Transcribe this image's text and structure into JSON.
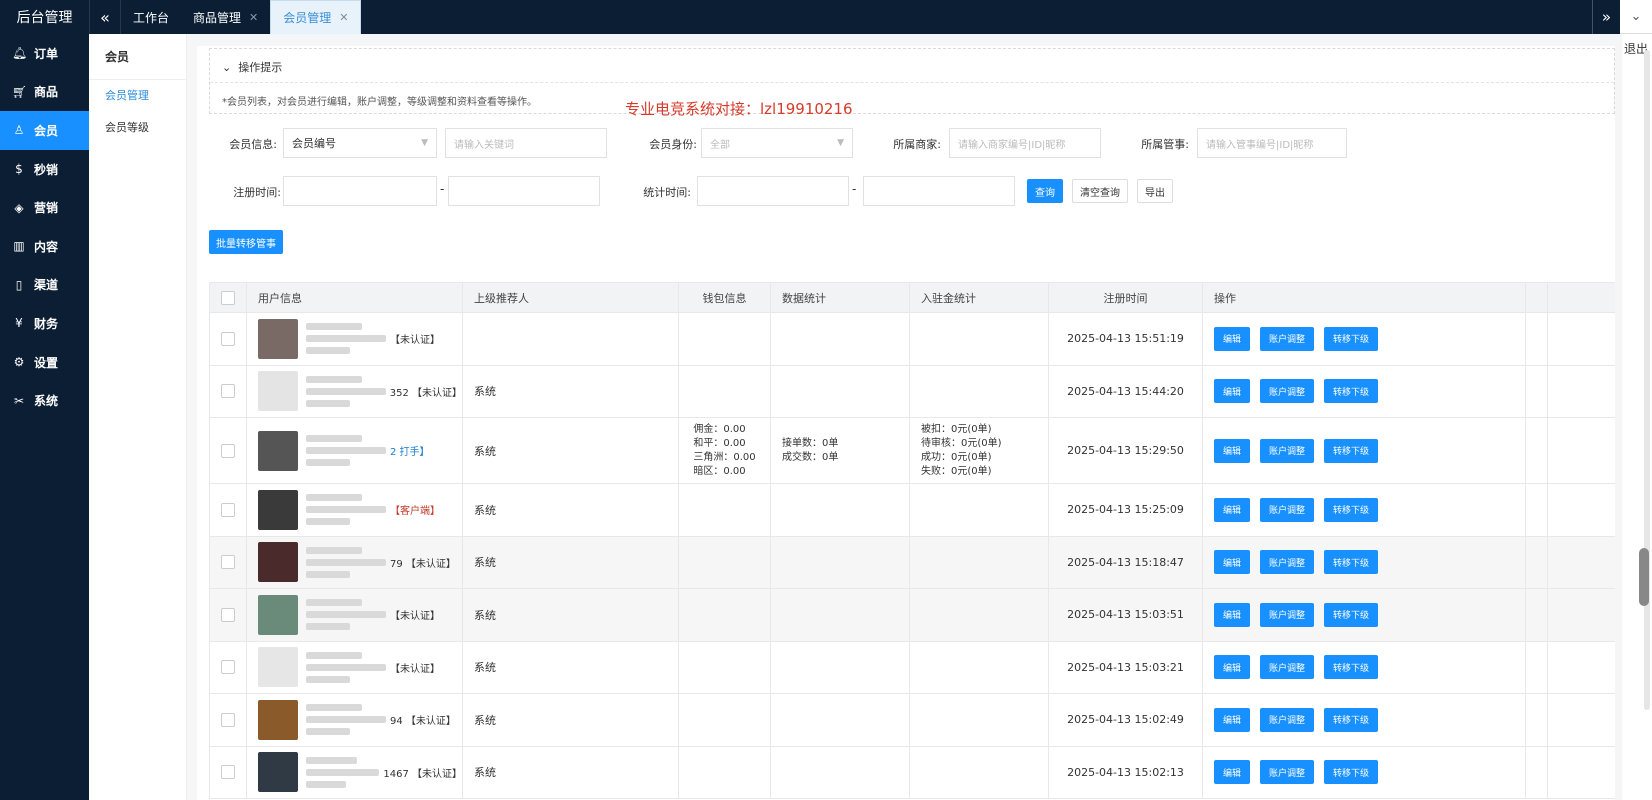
{
  "brand": "后台管理",
  "tabs": [
    {
      "label": "工作台",
      "closable": false,
      "active": false
    },
    {
      "label": "商品管理",
      "closable": true,
      "active": false
    },
    {
      "label": "会员管理",
      "closable": true,
      "active": true
    }
  ],
  "sidebar": {
    "items": [
      {
        "label": "订单",
        "icon": "bell-icon"
      },
      {
        "label": "商品",
        "icon": "cart-icon"
      },
      {
        "label": "会员",
        "icon": "user-icon",
        "active": true
      },
      {
        "label": "秒销",
        "icon": "dollar-icon"
      },
      {
        "label": "营销",
        "icon": "cube-icon"
      },
      {
        "label": "内容",
        "icon": "book-icon"
      },
      {
        "label": "渠道",
        "icon": "phone-icon"
      },
      {
        "label": "财务",
        "icon": "yen-icon"
      },
      {
        "label": "设置",
        "icon": "gear-icon"
      },
      {
        "label": "系统",
        "icon": "tools-icon"
      }
    ]
  },
  "submenu": {
    "title": "会员",
    "items": [
      {
        "label": "会员管理",
        "active": true
      },
      {
        "label": "会员等级",
        "active": false
      }
    ]
  },
  "logout": "退出",
  "tips": {
    "title": "操作提示",
    "text": "*会员列表，对会员进行编辑，账户调整，等级调整和资料查看等操作。"
  },
  "watermark": "专业电竞系统对接：lzl19910216",
  "filters": {
    "member_info_label": "会员信息:",
    "member_info_select": "会员编号",
    "keyword_placeholder": "请输入关键词",
    "identity_label": "会员身份:",
    "identity_select": "全部",
    "merchant_label": "所属商家:",
    "merchant_placeholder": "请输入商家编号|ID|昵称",
    "manager_label": "所属管事:",
    "manager_placeholder": "请输入管事编号|ID|昵称",
    "register_label": "注册时间:",
    "stat_label": "统计时间:",
    "range_sep": "-",
    "query": "查询",
    "clear": "清空查询",
    "export": "导出"
  },
  "batch_button": "批量转移管事",
  "table": {
    "headers": [
      "用户信息",
      "上级推荐人",
      "钱包信息",
      "数据统计",
      "入驻金统计",
      "注册时间",
      "操作"
    ],
    "actions": {
      "edit": "编辑",
      "adjust": "账户调整",
      "transfer": "转移下级"
    },
    "rows": [
      {
        "user_tag": "【未认证】",
        "tag_color": "normal",
        "referrer": "",
        "wallet": [],
        "stats": [],
        "deposit": [],
        "time": "2025-04-13 15:51:19",
        "alt": false
      },
      {
        "user_tag": "352 【未认证】",
        "tag_color": "normal",
        "referrer": "系统",
        "wallet": [],
        "stats": [],
        "deposit": [],
        "time": "2025-04-13 15:44:20",
        "alt": false
      },
      {
        "user_tag": "2 打手】",
        "tag_color": "blue",
        "referrer": "系统",
        "wallet": [
          "佣金：0.00",
          "和平：0.00",
          "三角洲：0.00",
          "暗区：0.00"
        ],
        "stats": [
          "接单数：0单",
          "成交数：0单"
        ],
        "deposit": [
          "被扣：0元(0单)",
          "待审核：0元(0单)",
          "成功：0元(0单)",
          "失败：0元(0单)"
        ],
        "time": "2025-04-13 15:29:50",
        "alt": false
      },
      {
        "user_tag": "【客户端】",
        "tag_color": "red",
        "referrer": "系统",
        "wallet": [],
        "stats": [],
        "deposit": [],
        "time": "2025-04-13 15:25:09",
        "alt": false
      },
      {
        "user_tag": "79 【未认证】",
        "tag_color": "normal",
        "referrer": "系统",
        "wallet": [],
        "stats": [],
        "deposit": [],
        "time": "2025-04-13 15:18:47",
        "alt": true
      },
      {
        "user_tag": "【未认证】",
        "tag_color": "normal",
        "referrer": "系统",
        "wallet": [],
        "stats": [],
        "deposit": [],
        "time": "2025-04-13 15:03:51",
        "alt": true
      },
      {
        "user_tag": "【未认证】",
        "tag_color": "normal",
        "referrer": "系统",
        "wallet": [],
        "stats": [],
        "deposit": [],
        "time": "2025-04-13 15:03:21",
        "alt": false
      },
      {
        "user_tag": "94 【未认证】",
        "tag_color": "normal",
        "referrer": "系统",
        "wallet": [],
        "stats": [],
        "deposit": [],
        "time": "2025-04-13 15:02:49",
        "alt": false
      },
      {
        "user_tag": "1467 【未认证】",
        "tag_color": "normal",
        "referrer": "系统",
        "wallet": [],
        "stats": [],
        "deposit": [],
        "time": "2025-04-13 15:02:13",
        "alt": false
      }
    ]
  }
}
